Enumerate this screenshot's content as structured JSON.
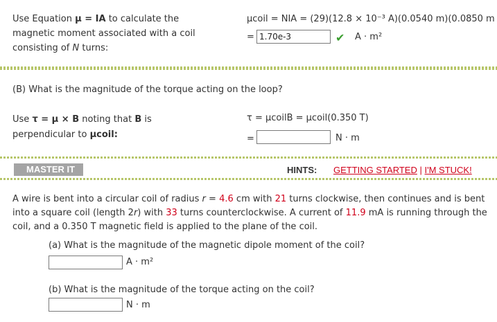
{
  "part_a_result": {
    "instruction_prefix": "Use Equation",
    "equation_symbols": "μ = IA",
    "instruction_suffix": "to calculate the",
    "line2": "magnetic moment associated with a coil",
    "line3_prefix": "consisting of",
    "line3_var": "N",
    "line3_suffix": "turns:",
    "formula": "μcoil = NIA = (29)(12.8 × 10⁻³ A)(0.0540 m)(0.0850 m",
    "answer_value": "1.70e-3",
    "equals": "=",
    "unit": "A · m²",
    "status": "correct"
  },
  "part_b": {
    "question": "(B) What is the magnitude of the torque acting on the loop?",
    "use_prefix": "Use",
    "use_expr": "τ = μ × B",
    "use_suffix": "noting that",
    "use_b": "B",
    "use_is": "is",
    "line2": "perpendicular to",
    "line2_var": "μcoil:",
    "formula": "τ = μcoilB = μcoil(0.350 T)",
    "equals": "=",
    "answer_value": "",
    "unit": "N · m"
  },
  "master": {
    "label": "MASTER IT",
    "hints_label": "HINTS:",
    "link1": "GETTING STARTED",
    "separator": "|",
    "link2": "I'M STUCK!",
    "problem_1": "A wire is bent into a circular coil of radius",
    "r_var": "r",
    "eq": "=",
    "radius_value": "4.6",
    "radius_unit": "cm with",
    "turns1": "21",
    "turns1_suffix": "turns clockwise, then continues and is bent",
    "problem_2_prefix": "into a square coil (length 2",
    "problem_2_r": "r",
    "problem_2_mid": ") with",
    "turns2": "33",
    "turns2_suffix": "turns counterclockwise. A current of",
    "current_value": "11.9",
    "current_unit": "mA is running through the",
    "problem_3": "coil, and a 0.350 T magnetic field is applied to the plane of the coil.",
    "qa": "(a) What is the magnitude of the magnetic dipole moment of the coil?",
    "qa_answer": "",
    "qa_unit": "A · m²",
    "qb": "(b) What is the magnitude of the torque acting on the coil?",
    "qb_answer": "",
    "qb_unit": "N · m"
  },
  "colors": {
    "accent_red": "#d0021b",
    "check_green": "#3a9e2f",
    "divider_green": "#b7c66a",
    "master_badge_gray": "#a4a4a4"
  }
}
